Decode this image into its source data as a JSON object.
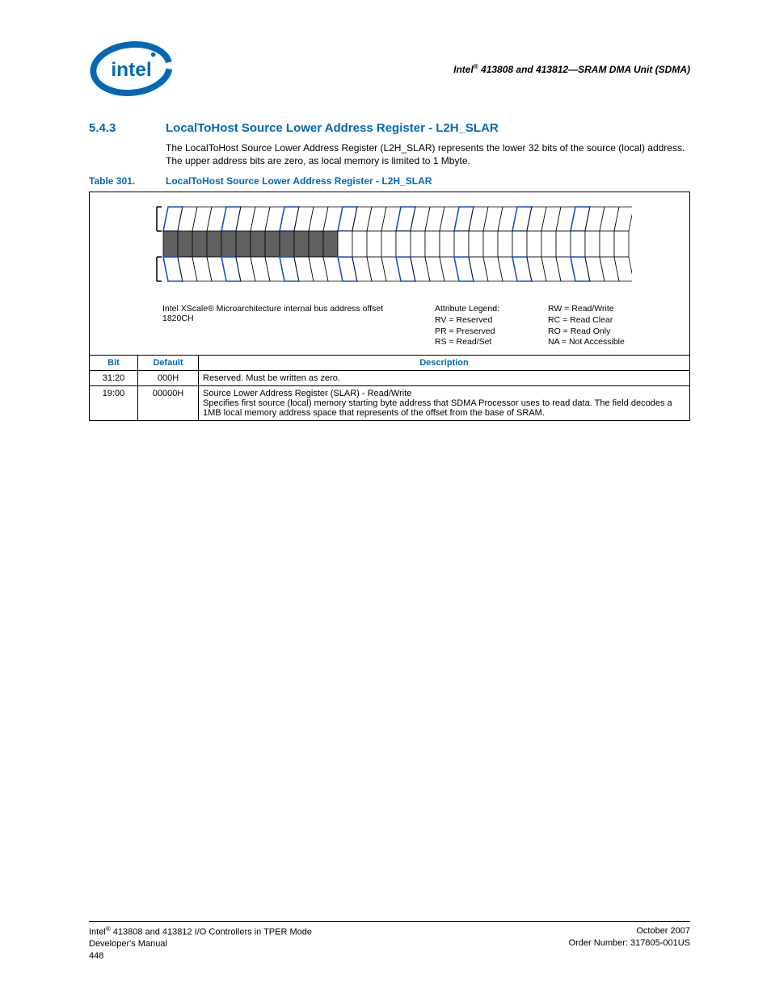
{
  "header": {
    "right_text": "Intel® 413808 and 413812—SRAM DMA Unit (SDMA)"
  },
  "section": {
    "number": "5.4.3",
    "title": "LocalToHost Source Lower Address Register - L2H_SLAR",
    "paragraph": "The LocalToHost Source Lower Address Register (L2H_SLAR) represents the lower 32 bits of the source (local) address. The upper address bits are zero, as local memory is limited to 1 Mbyte."
  },
  "table_caption": {
    "number": "Table 301.",
    "title": "LocalToHost Source Lower Address Register - L2H_SLAR"
  },
  "diagram": {
    "offset_line1": "Intel XScale® Microarchitecture internal bus address offset",
    "offset_line2": "1820CH",
    "legend_title": "Attribute Legend:",
    "legend_left": [
      "RV = Reserved",
      "PR = Preserved",
      "RS = Read/Set"
    ],
    "legend_right": [
      "RW = Read/Write",
      "RC = Read Clear",
      "RO = Read Only",
      "NA = Not Accessible"
    ]
  },
  "columns": {
    "bit": "Bit",
    "default": "Default",
    "description": "Description"
  },
  "rows": [
    {
      "bit": "31:20",
      "default": "000H",
      "description": "Reserved. Must be written as zero."
    },
    {
      "bit": "19:00",
      "default": "00000H",
      "description": "Source Lower Address Register (SLAR) - Read/Write\nSpecifies first source (local) memory starting byte address that SDMA Processor uses to read data. The field decodes a 1MB local memory address space that represents of the offset from the base of SRAM."
    }
  ],
  "footer": {
    "left_line1": "Intel® 413808 and 413812 I/O Controllers in TPER Mode",
    "left_line2": "Developer's Manual",
    "left_line3": "448",
    "right_line1": "October 2007",
    "right_line2": "Order Number: 317805-001US"
  }
}
